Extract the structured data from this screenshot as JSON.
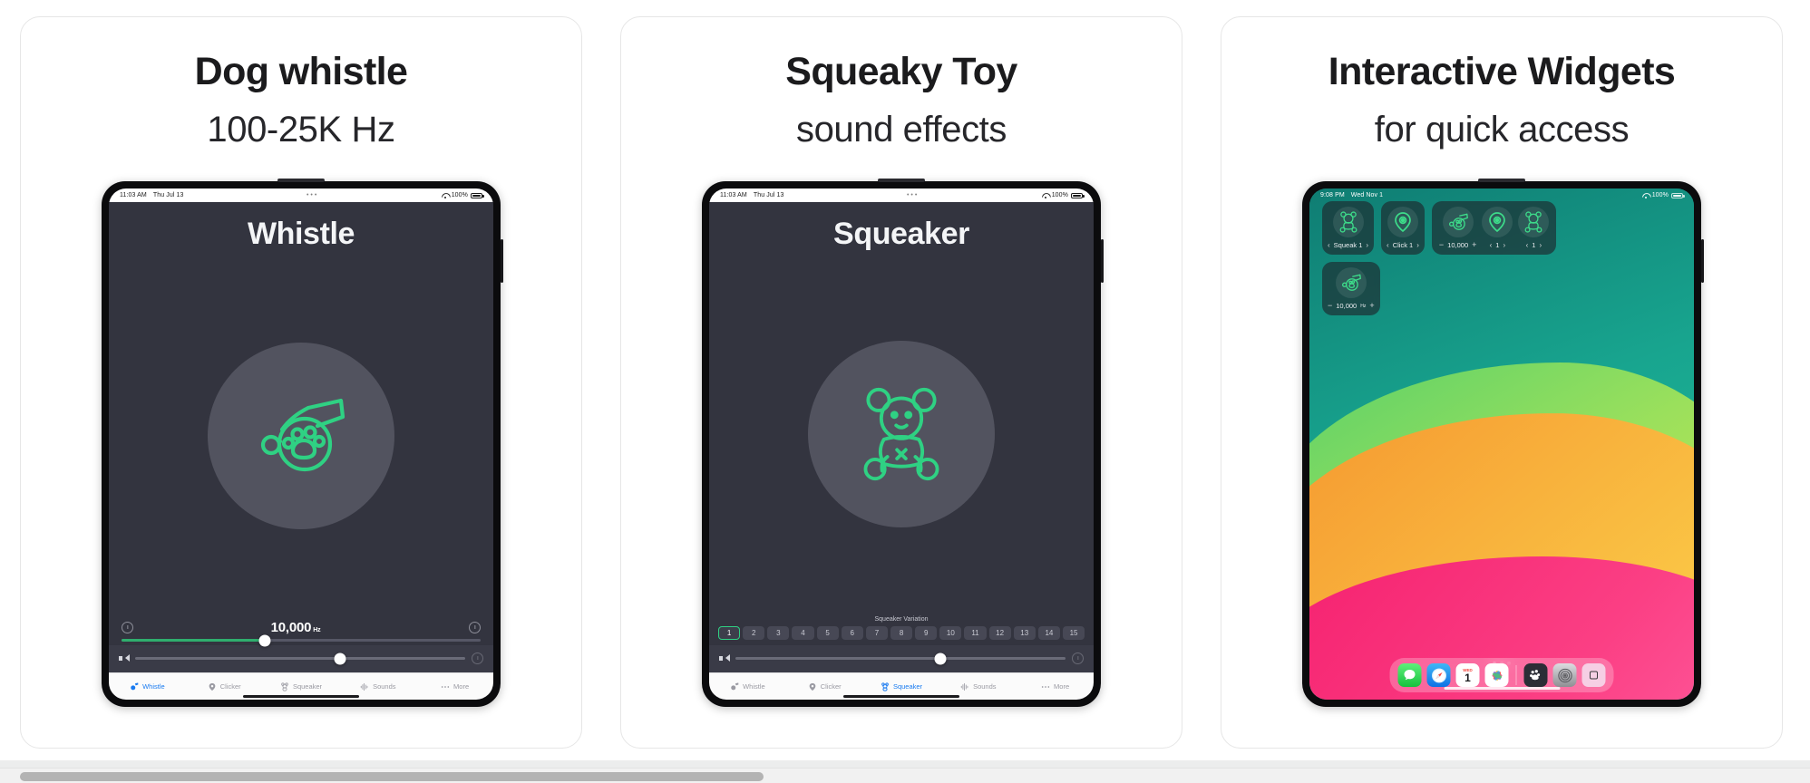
{
  "colors": {
    "accent_green": "#2fd183",
    "accent_blue": "#1a7bf0",
    "app_bg": "#33343f",
    "card_border": "#e6e6e6"
  },
  "cards": [
    {
      "title": "Dog whistle",
      "subtitle": "100-25K Hz",
      "device": {
        "status": {
          "time": "11:03 AM",
          "date": "Thu Jul 13",
          "mid": "•••",
          "battery": "100%"
        },
        "app_title": "Whistle",
        "hero_icon": "dog-whistle-paw-icon",
        "frequency_value": "10,000",
        "frequency_unit": "Hz",
        "frequency_slider_percent": 40,
        "volume_slider_percent": 62,
        "tabs": [
          {
            "label": "Whistle",
            "icon": "whistle-icon",
            "active": true
          },
          {
            "label": "Clicker",
            "icon": "clicker-icon",
            "active": false
          },
          {
            "label": "Squeaker",
            "icon": "squeaker-icon",
            "active": false
          },
          {
            "label": "Sounds",
            "icon": "waveform-icon",
            "active": false
          },
          {
            "label": "More",
            "icon": "ellipsis-icon",
            "active": false
          }
        ]
      }
    },
    {
      "title": "Squeaky Toy",
      "subtitle": "sound effects",
      "device": {
        "status": {
          "time": "11:03 AM",
          "date": "Thu Jul 13",
          "mid": "•••",
          "battery": "100%"
        },
        "app_title": "Squeaker",
        "hero_icon": "teddy-bear-icon",
        "variation_label": "Squeaker Variation",
        "variations": [
          "1",
          "2",
          "3",
          "4",
          "5",
          "6",
          "7",
          "8",
          "9",
          "10",
          "11",
          "12",
          "13",
          "14",
          "15"
        ],
        "selected_variation": "1",
        "volume_slider_percent": 62,
        "tabs": [
          {
            "label": "Whistle",
            "icon": "whistle-icon",
            "active": false
          },
          {
            "label": "Clicker",
            "icon": "clicker-icon",
            "active": false
          },
          {
            "label": "Squeaker",
            "icon": "squeaker-icon",
            "active": true
          },
          {
            "label": "Sounds",
            "icon": "waveform-icon",
            "active": false
          },
          {
            "label": "More",
            "icon": "ellipsis-icon",
            "active": false
          }
        ]
      }
    },
    {
      "title": "Interactive Widgets",
      "subtitle": "for quick access",
      "device": {
        "status": {
          "time": "9:08 PM",
          "date": "Wed Nov 1",
          "mid": "",
          "battery": "100%"
        },
        "widgets": [
          {
            "name": "squeak-widget",
            "icon": "teddy-bear-icon",
            "label": "Squeak 1",
            "prev": "‹",
            "next": "›"
          },
          {
            "name": "clicker-widget",
            "icon": "clicker-icon",
            "label": "Click 1",
            "prev": "‹",
            "next": "›"
          }
        ],
        "wide_widget": {
          "name": "combo-widget",
          "cells": [
            {
              "icon": "dog-whistle-paw-icon",
              "minus": "−",
              "value": "10,000",
              "plus": "+"
            },
            {
              "icon": "clicker-icon",
              "prev": "‹",
              "value": "1",
              "next": "›"
            },
            {
              "icon": "teddy-bear-icon",
              "prev": "‹",
              "value": "1",
              "next": "›"
            }
          ]
        },
        "whistle_widget": {
          "name": "whistle-widget",
          "icon": "dog-whistle-paw-icon",
          "minus": "−",
          "value": "10,000",
          "unit": "Hz",
          "plus": "+"
        },
        "dock": [
          {
            "name": "messages-app",
            "label": "Messages"
          },
          {
            "name": "safari-app",
            "label": "Safari"
          },
          {
            "name": "calendar-app",
            "label": "Calendar",
            "weekday": "WED",
            "day": "1"
          },
          {
            "name": "photos-app",
            "label": "Photos"
          },
          {
            "name": "dogwhistle-app",
            "label": "Dog Whistle"
          },
          {
            "name": "settings-app",
            "label": "Settings"
          },
          {
            "name": "recent-app",
            "label": "Recent"
          }
        ]
      }
    }
  ]
}
